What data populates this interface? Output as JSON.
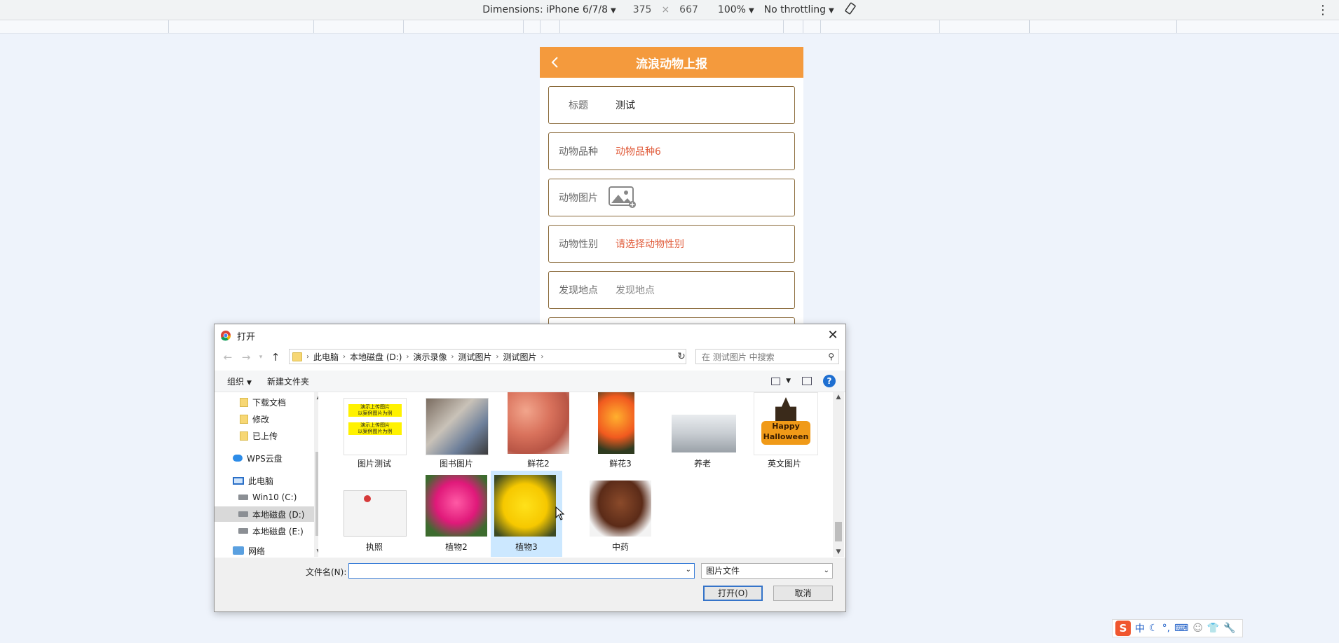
{
  "devtools": {
    "dimensions_label": "Dimensions: iPhone 6/7/8",
    "width": "375",
    "times": "×",
    "height": "667",
    "zoom": "100%",
    "throttling": "No throttling"
  },
  "phone": {
    "title": "流浪动物上报",
    "rows": [
      {
        "label": "标题",
        "value": "测试"
      },
      {
        "label": "动物品种",
        "value": "动物品种6"
      },
      {
        "label": "动物图片",
        "value": ""
      },
      {
        "label": "动物性别",
        "value": "请选择动物性别"
      },
      {
        "label": "发现地点",
        "value": "发现地点"
      }
    ]
  },
  "dialog": {
    "title": "打开",
    "close": "✕",
    "breadcrumb": [
      "此电脑",
      "本地磁盘 (D:)",
      "演示录像",
      "测试图片",
      "测试图片"
    ],
    "search_placeholder": "在 测试图片 中搜索",
    "toolbar": {
      "organize": "组织",
      "new_folder": "新建文件夹",
      "help": "?"
    },
    "tree": [
      {
        "label": "下载文档",
        "icon": "folder"
      },
      {
        "label": "修改",
        "icon": "folder"
      },
      {
        "label": "已上传",
        "icon": "folder"
      },
      {
        "label": "WPS云盘",
        "icon": "cloud"
      },
      {
        "label": "此电脑",
        "icon": "pc"
      },
      {
        "label": "Win10 (C:)",
        "icon": "drive"
      },
      {
        "label": "本地磁盘 (D:)",
        "icon": "drive",
        "selected": true
      },
      {
        "label": "本地磁盘 (E:)",
        "icon": "drive"
      },
      {
        "label": "网络",
        "icon": "network"
      }
    ],
    "files": [
      {
        "name": "图片测试",
        "text1": "演示上传图片\n以案例图片为例",
        "text2": "演示上传图片\n以案例图片为例"
      },
      {
        "name": "图书图片"
      },
      {
        "name": "鲜花2"
      },
      {
        "name": "鲜花3"
      },
      {
        "name": "养老"
      },
      {
        "name": "英文图片",
        "text1": "Happy Halloween"
      },
      {
        "name": "执照"
      },
      {
        "name": "植物2"
      },
      {
        "name": "植物3",
        "selected": true
      },
      {
        "name": "中药"
      }
    ],
    "filename_label": "文件名(N):",
    "filename_value": "",
    "filetype": "图片文件",
    "open_button": "打开(O)",
    "cancel_button": "取消"
  },
  "ime": {
    "logo": "S",
    "lang": "中"
  }
}
